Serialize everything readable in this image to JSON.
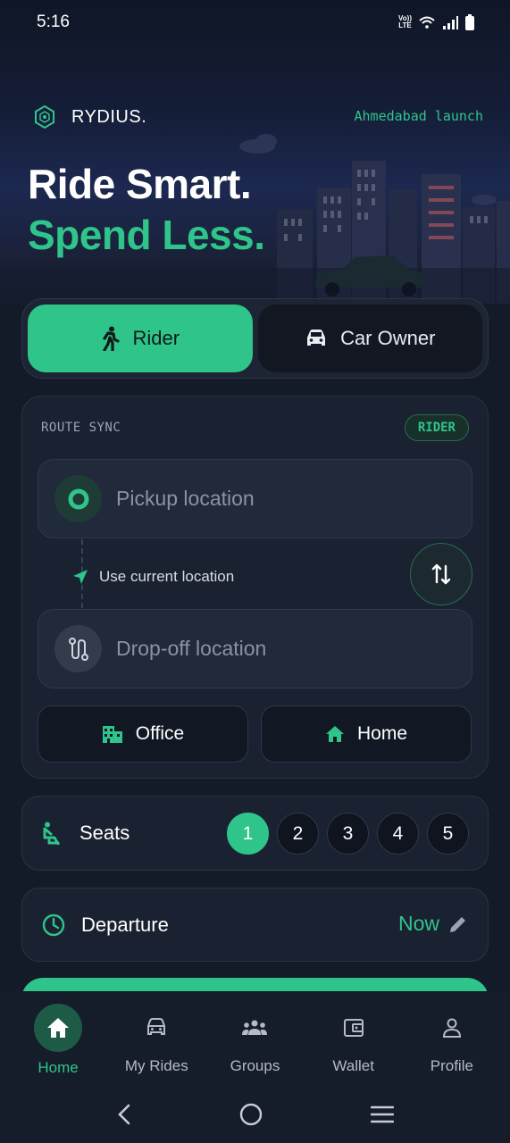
{
  "status_bar": {
    "time": "5:16",
    "network_label": "Vo)) LTE"
  },
  "header": {
    "brand": "RYDIUS.",
    "launch_tag": "Ahmedabad launch"
  },
  "hero": {
    "line1": "Ride Smart.",
    "line2": "Spend Less."
  },
  "role_toggle": {
    "rider_label": "Rider",
    "owner_label": "Car Owner",
    "selected": "Rider"
  },
  "route": {
    "section_label": "ROUTE SYNC",
    "badge": "RIDER",
    "pickup_placeholder": "Pickup location",
    "use_current": "Use current location",
    "dropoff_placeholder": "Drop-off location",
    "quick": {
      "office": "Office",
      "home": "Home"
    }
  },
  "seats": {
    "label": "Seats",
    "options": [
      "1",
      "2",
      "3",
      "4",
      "5"
    ],
    "selected": "1"
  },
  "departure": {
    "label": "Departure",
    "value": "Now"
  },
  "bottom_nav": {
    "home": "Home",
    "rides": "My Rides",
    "groups": "Groups",
    "wallet": "Wallet",
    "profile": "Profile",
    "active": "Home"
  },
  "colors": {
    "accent": "#2fc48a",
    "background": "#131a28",
    "card": "#1a2231"
  },
  "icons": [
    "hexagon-logo-icon",
    "walking-person-icon",
    "car-icon",
    "pickup-dot-icon",
    "route-icon",
    "navigation-arrow-icon",
    "swap-icon",
    "office-building-icon",
    "home-icon",
    "seat-icon",
    "clock-icon",
    "edit-pencil-icon",
    "group-icon",
    "wallet-icon",
    "person-icon"
  ]
}
